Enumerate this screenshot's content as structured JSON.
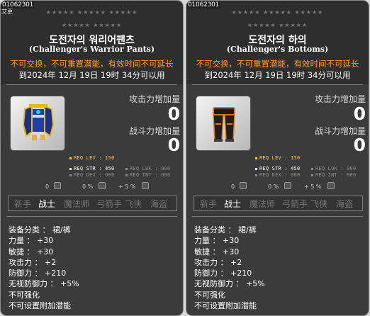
{
  "colors": {
    "card_bg": "#3b3b3b",
    "header_bg": "#2e2e2e",
    "notice_orange": "#ff9c1a",
    "req_level_yellow": "#ffcc33",
    "disabled_gray": "#8c8c8c"
  },
  "cards": [
    {
      "item_id": "01062301",
      "sub_label": "艾更",
      "stars_row1": "★★★★★ ★★★★★ ★★★★★",
      "stars_row2": "★★★★★ ★★★★★",
      "title": "도전자의 워리어팬츠",
      "title_en": "(Challenger's Warrior Pants)",
      "notice": "不可交换，不可重置潜能，有效时间不可延长",
      "expiry": "到2024年 12月 19日 19时 34分可以用",
      "attack_label": "攻击力增加量",
      "attack_value": "0",
      "combat_label": "战斗力增加量",
      "combat_value": "0",
      "icon": "warrior-pants-icon",
      "req_lev": "REQ LEV : 150",
      "req_str": "REQ STR : 450",
      "req_dex": "REQ DEX : 000",
      "req_luk": "REQ LUK : 000",
      "req_int": "REQ INT : 000",
      "mini1": "0",
      "mini2": "0 %",
      "mini3": "+ 5 %",
      "jobs": [
        "新手",
        "战士",
        "魔法师",
        "弓箭手",
        "飞侠",
        "海盗"
      ],
      "active_job": "战士",
      "details": [
        "装备分类 ： 裙/裤",
        "力量 ： +30",
        "敏捷 ： +30",
        "攻击力 ： +2",
        "防御力 ： +210",
        "无视防御力 ： +5%",
        "不可强化",
        "不可设置附加潜能"
      ]
    },
    {
      "item_id": "01062301",
      "sub_label": "",
      "stars_row1": "★★★★★ ★★★★★ ★★★★★",
      "stars_row2": "★★★★★ ★★★★★",
      "title": "도전자의 하의",
      "title_en": "(Challenger's Bottoms)",
      "notice": "不可交换，不可重置潜能，有效时间不可延长",
      "expiry": "到2024年 12月 19日 19时 34分可以用",
      "attack_label": "攻击力增加量",
      "attack_value": "0",
      "combat_label": "战斗力增加量",
      "combat_value": "0",
      "icon": "bottoms-icon",
      "req_lev": "REQ LEV : 150",
      "req_str": "REQ STR : 450",
      "req_dex": "REQ DEX : 000",
      "req_luk": "REQ LUK : 000",
      "req_int": "REQ INT : 000",
      "mini1": "0",
      "mini2": "0 %",
      "mini3": "+ 5 %",
      "jobs": [
        "新手",
        "战士",
        "魔法师",
        "弓箭手",
        "飞侠",
        "海盗"
      ],
      "active_job": "战士",
      "details": [
        "装备分类 ： 裙/裤",
        "力量 ： +30",
        "敏捷 ： +30",
        "攻击力 ： +2",
        "防御力 ： +210",
        "无视防御力 ： +5%",
        "不可强化",
        "不可设置附加潜能"
      ]
    }
  ]
}
